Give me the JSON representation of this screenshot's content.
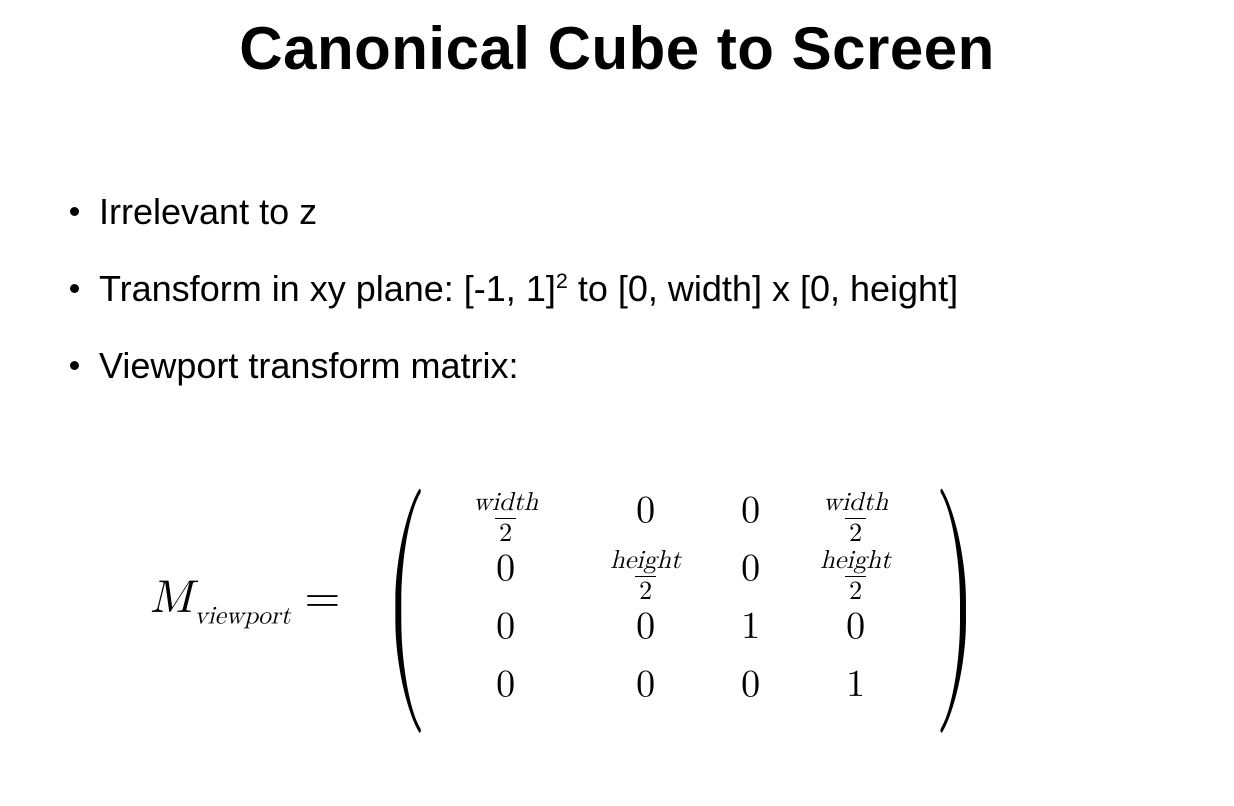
{
  "title": "Canonical Cube to Screen",
  "bullets": {
    "b1": "Irrelevant to z",
    "b2_pre": "Transform in xy plane: [-1, 1]",
    "b2_sup": "2",
    "b2_post": " to [0, width] x [0, height]",
    "b3": "Viewport transform matrix:"
  },
  "equation": {
    "lhs_sym": "M",
    "lhs_sub": "viewport",
    "eq": "=",
    "matrix": {
      "r1c1_num": "width",
      "r1c1_den": "2",
      "r1c2": "0",
      "r1c3": "0",
      "r1c4_num": "width",
      "r1c4_den": "2",
      "r2c1": "0",
      "r2c2_num": "height",
      "r2c2_den": "2",
      "r2c3": "0",
      "r2c4_num": "height",
      "r2c4_den": "2",
      "r3c1": "0",
      "r3c2": "0",
      "r3c3": "1",
      "r3c4": "0",
      "r4c1": "0",
      "r4c2": "0",
      "r4c3": "0",
      "r4c4": "1"
    }
  }
}
